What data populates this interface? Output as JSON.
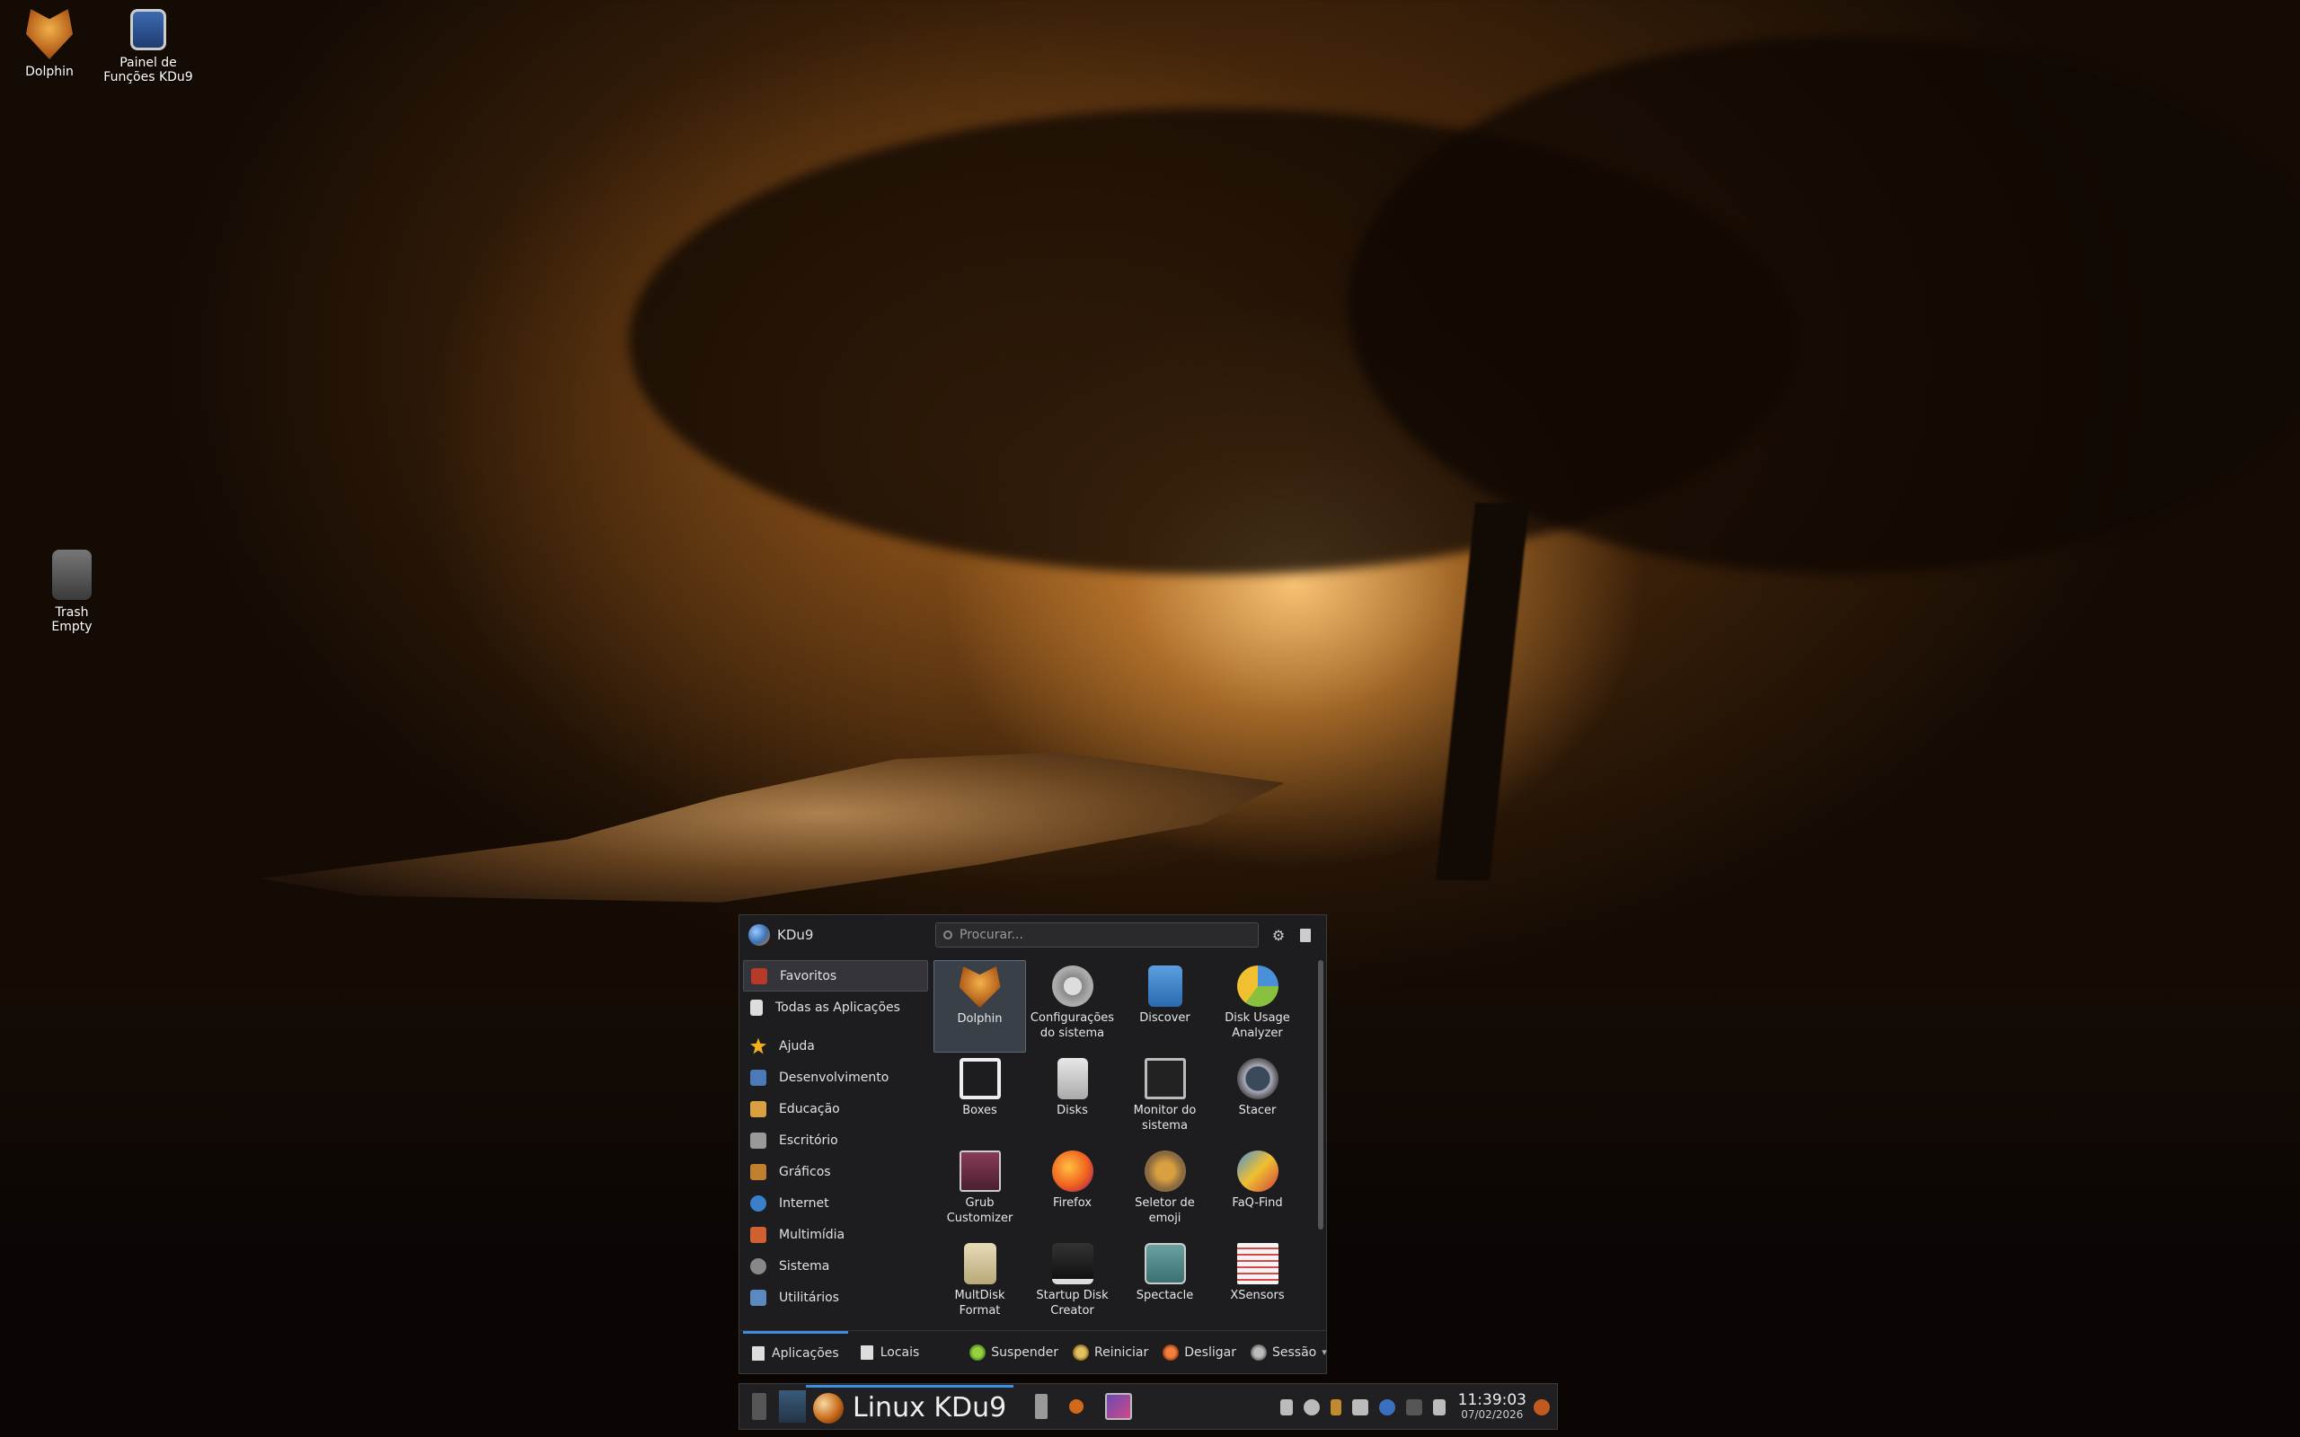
{
  "desktop": {
    "icons": [
      {
        "label": "Dolphin"
      },
      {
        "label": "Painel de Funções KDu9"
      },
      {
        "label": "Trash Empty"
      }
    ]
  },
  "menu": {
    "user": "KDu9",
    "search_placeholder": "Procurar...",
    "categories": [
      {
        "label": "Favoritos",
        "icon": "star-red-icon"
      },
      {
        "label": "Todas as Aplicações",
        "icon": "document-icon"
      },
      {
        "label": "Ajuda",
        "icon": "star-icon"
      },
      {
        "label": "Desenvolvimento",
        "icon": "development-icon"
      },
      {
        "label": "Educação",
        "icon": "education-icon"
      },
      {
        "label": "Escritório",
        "icon": "office-icon"
      },
      {
        "label": "Gráficos",
        "icon": "graphics-icon"
      },
      {
        "label": "Internet",
        "icon": "globe-icon"
      },
      {
        "label": "Multimídia",
        "icon": "multimedia-icon"
      },
      {
        "label": "Sistema",
        "icon": "system-icon"
      },
      {
        "label": "Utilitários",
        "icon": "utilities-icon"
      }
    ],
    "apps": [
      {
        "label": "Dolphin",
        "icon": "dolphin-icon"
      },
      {
        "label": "Configurações do sistema",
        "icon": "settings-icon"
      },
      {
        "label": "Discover",
        "icon": "discover-icon"
      },
      {
        "label": "Disk Usage Analyzer",
        "icon": "disk-usage-icon"
      },
      {
        "label": "Boxes",
        "icon": "boxes-icon"
      },
      {
        "label": "Disks",
        "icon": "disks-icon"
      },
      {
        "label": "Monitor do sistema",
        "icon": "system-monitor-icon"
      },
      {
        "label": "Stacer",
        "icon": "stacer-icon"
      },
      {
        "label": "Grub Customizer",
        "icon": "grub-icon"
      },
      {
        "label": "Firefox",
        "icon": "firefox-icon"
      },
      {
        "label": "Seletor de emoji",
        "icon": "emoji-icon"
      },
      {
        "label": "FaQ-Find",
        "icon": "faq-find-icon"
      },
      {
        "label": "MultDisk Format",
        "icon": "iso-icon"
      },
      {
        "label": "Startup Disk Creator",
        "icon": "startup-disk-icon"
      },
      {
        "label": "Spectacle",
        "icon": "spectacle-icon"
      },
      {
        "label": "XSensors",
        "icon": "xsensors-icon"
      }
    ],
    "footer": {
      "tab_apps": "Aplicações",
      "tab_places": "Locais",
      "suspend": "Suspender",
      "restart": "Reiniciar",
      "shutdown": "Desligar",
      "session": "Sessão"
    }
  },
  "taskbar": {
    "launcher_label": "Linux KDu9",
    "time": "11:39:03",
    "date": "07/02/2026"
  }
}
